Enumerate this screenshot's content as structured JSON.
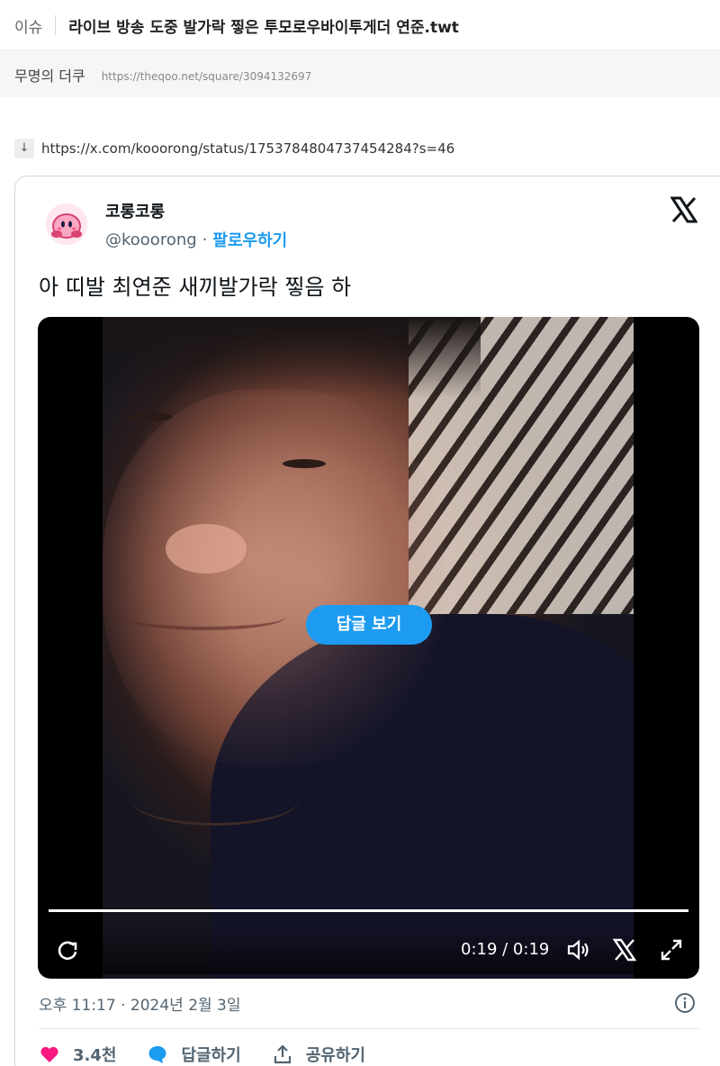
{
  "post": {
    "category": "이슈",
    "title": "라이브 방송 도중 발가락 찧은 투모로우바이투게더 연준.twt",
    "author": "무명의 더쿠",
    "url": "https://theqoo.net/square/3094132697"
  },
  "source_link": {
    "arrow": "↓",
    "url": "https://x.com/kooorong/status/1753784804737454284?s=46"
  },
  "tweet": {
    "display_name": "코롱코롱",
    "handle": "@kooorong",
    "separator": "·",
    "follow_label": "팔로우하기",
    "text": "아 띠발 최연준 새끼발가락 찧음 하",
    "timestamp": "오후 11:17 · 2024년 2월 3일",
    "colors": {
      "accent": "#1d9bf0",
      "like": "#f91880",
      "muted": "#536471"
    }
  },
  "video": {
    "replies_button_label": "답글 보기",
    "time": "0:19 / 0:19",
    "progress_fraction": 1.0,
    "icons": [
      "replay-icon",
      "volume-icon",
      "x-logo-icon",
      "fullscreen-icon"
    ]
  },
  "actions": {
    "like_count": "3.4천",
    "reply_label": "답글하기",
    "share_label": "공유하기"
  }
}
